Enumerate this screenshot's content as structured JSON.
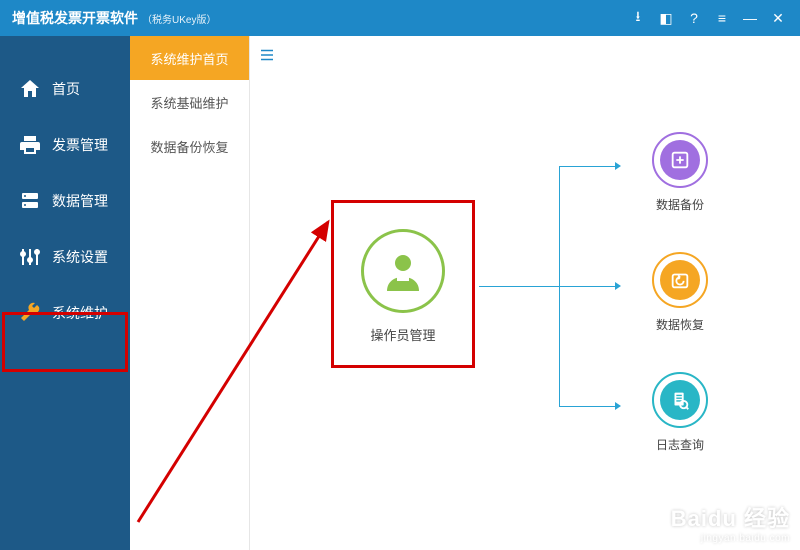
{
  "app": {
    "title": "增值税发票开票软件",
    "subtitle": "（税务UKey版）"
  },
  "titlebar_icons": [
    "download",
    "bookmark",
    "help",
    "menu",
    "minimize",
    "close"
  ],
  "sidebar": {
    "items": [
      {
        "label": "首页",
        "icon": "home"
      },
      {
        "label": "发票管理",
        "icon": "printer"
      },
      {
        "label": "数据管理",
        "icon": "database"
      },
      {
        "label": "系统设置",
        "icon": "sliders"
      },
      {
        "label": "系统维护",
        "icon": "wrench"
      }
    ],
    "active_index": 4
  },
  "submenu": {
    "items": [
      "系统维护首页",
      "系统基础维护",
      "数据备份恢复"
    ],
    "active_index": 0
  },
  "diagram": {
    "center": {
      "label": "操作员管理"
    },
    "children": [
      {
        "label": "数据备份"
      },
      {
        "label": "数据恢复"
      },
      {
        "label": "日志查询"
      }
    ]
  },
  "watermark": {
    "brand": "Baidu 经验",
    "url": "jingyan.baidu.com"
  }
}
